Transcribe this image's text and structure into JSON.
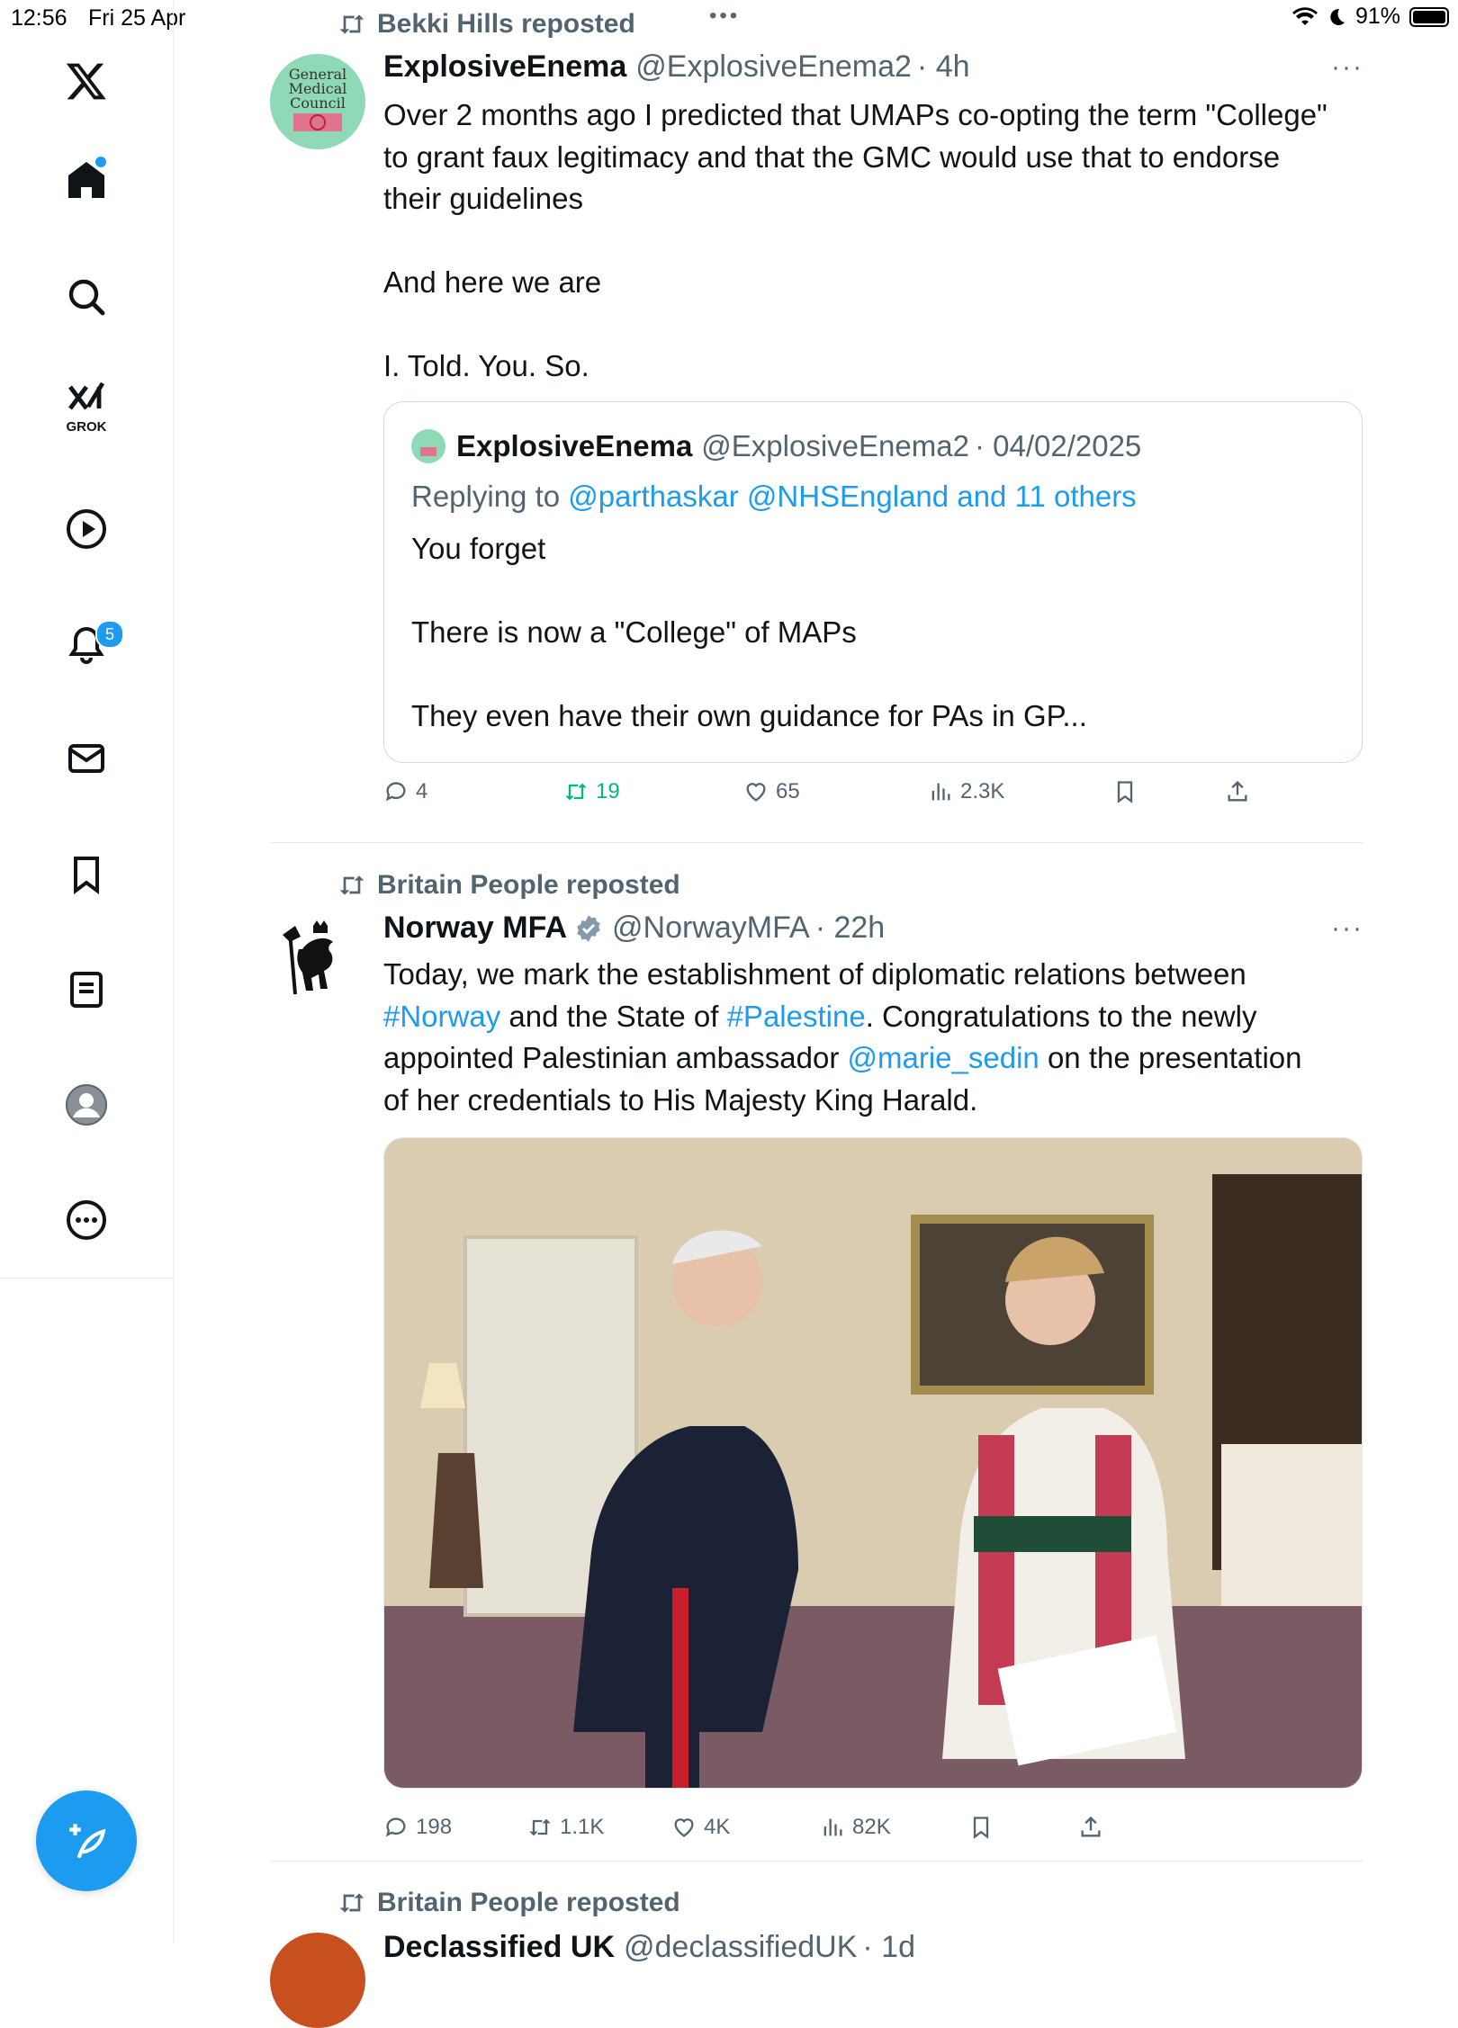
{
  "status_bar": {
    "time": "12:56",
    "date": "Fri 25 Apr",
    "battery": "91%"
  },
  "sidebar": {
    "grok_label": "GROK",
    "notifications_badge": "5",
    "icons": [
      "x-logo-icon",
      "home-icon",
      "search-icon",
      "grok-icon",
      "play-icon",
      "bell-icon",
      "mail-icon",
      "bookmark-icon",
      "list-icon",
      "profile-icon",
      "more-icon"
    ],
    "accent": "#1d9bf0"
  },
  "tweets": [
    {
      "repost_by": "Bekki Hills reposted",
      "name": "ExplosiveEnema",
      "handle": "@ExplosiveEnema2",
      "time": "· 4h",
      "text": "Over 2 months ago I predicted that UMAPs co-opting the term \"College\"\nto grant faux legitimacy and that the GMC would use that to endorse\ntheir guidelines\n\nAnd here we are\n\nI. Told. You. So.",
      "avatar_text": [
        "General",
        "Medical",
        "Council"
      ],
      "quote": {
        "name": "ExplosiveEnema",
        "handle": "@ExplosiveEnema2",
        "date": "· 04/02/2025",
        "replying_prefix": "Replying to",
        "replying_to": "@parthaskar @NHSEngland and 11 others",
        "text": "You forget\n\nThere is now a \"College\" of MAPs\n\nThey even have their own guidance for PAs in GP..."
      },
      "stats": {
        "replies": "4",
        "reposts": "19",
        "likes": "65",
        "views": "2.3K"
      }
    },
    {
      "repost_by": "Britain People reposted",
      "name": "Norway MFA",
      "handle": "@NorwayMFA",
      "time": "· 22h",
      "text_parts": {
        "p1": "Today, we mark the establishment of diplomatic relations between\n",
        "tag1": "#Norway",
        "p2": " and the State of ",
        "tag2": "#Palestine",
        "p3": ". Congratulations to the newly\nappointed Palestinian ambassador ",
        "mention": "@marie_sedin",
        "p4": " on the presentation\nof her credentials to His Majesty King Harald."
      },
      "stats": {
        "replies": "198",
        "reposts": "1.1K",
        "likes": "4K",
        "views": "82K"
      }
    },
    {
      "repost_by": "Britain People reposted",
      "name": "Declassified UK",
      "handle": "@declassifiedUK",
      "time": "· 1d"
    }
  ]
}
